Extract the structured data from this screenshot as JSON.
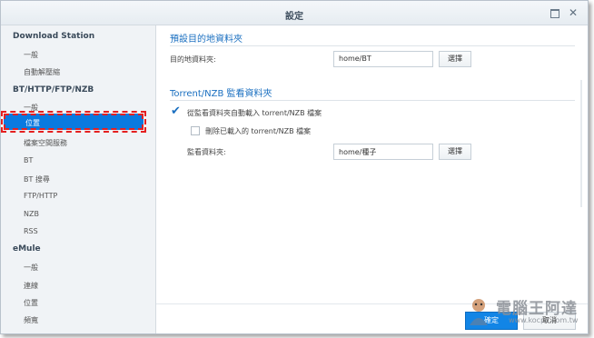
{
  "window": {
    "title": "設定"
  },
  "sidebar": {
    "groups": [
      {
        "label": "Download Station",
        "items": [
          "一般",
          "自動解壓縮"
        ]
      },
      {
        "label": "BT/HTTP/FTP/NZB",
        "items": [
          "一般",
          "位置",
          "檔案空間服務",
          "BT",
          "BT 搜尋",
          "FTP/HTTP",
          "NZB",
          "RSS"
        ]
      },
      {
        "label": "eMule",
        "items": [
          "一般",
          "連線",
          "位置",
          "頻寬"
        ]
      }
    ],
    "selected": "位置"
  },
  "main": {
    "section1": {
      "title": "預設目的地資料夾",
      "field_label": "目的地資料夾:",
      "field_value": "home/BT",
      "button_label": "選擇"
    },
    "section2": {
      "title": "Torrent/NZB 監看資料夾",
      "auto_load_label": "從監看資料夾自動載入 torrent/NZB 檔案",
      "auto_load_checked": true,
      "delete_label": "刪除已載入的 torrent/NZB 檔案",
      "delete_checked": false,
      "watch_label": "監看資料夾:",
      "watch_value": "home/種子",
      "button_label": "選擇"
    }
  },
  "footer": {
    "ok_label": "確定",
    "cancel_label": "取消"
  },
  "watermark": {
    "text": "電腦王阿達",
    "url": "www.kocpc.com.tw"
  },
  "colors": {
    "accent": "#0a7ae0",
    "section_title": "#1a6fc0",
    "highlight_border": "#e52020"
  }
}
